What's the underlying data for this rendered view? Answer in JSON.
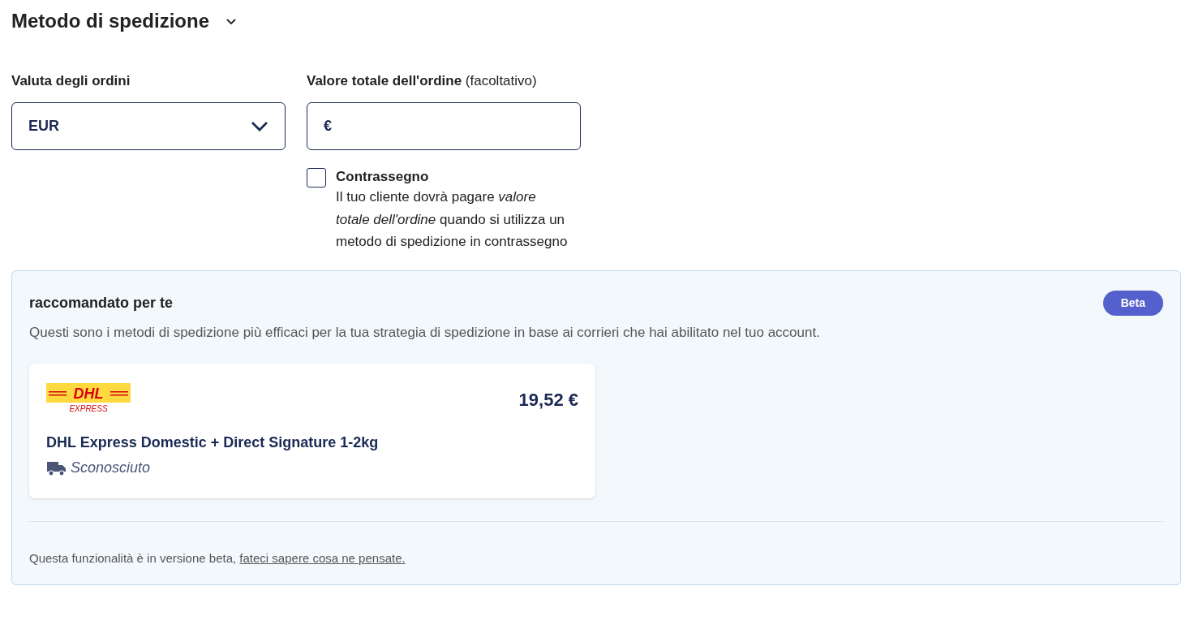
{
  "section": {
    "title": "Metodo di spedizione",
    "expanded": true
  },
  "currency": {
    "label": "Valuta degli ordini",
    "value": "EUR"
  },
  "order_value": {
    "label": "Valore totale dell'ordine",
    "label_note": "(facoltativo)",
    "prefix": "€"
  },
  "cash_on_delivery": {
    "label": "Contrassegno",
    "checked": false,
    "description": "Il tuo cliente dovrà pagare *valore totale dell'ordine* quando si utilizza un metodo di spedizione in contrassegno"
  },
  "recommended": {
    "title": "raccomandato per te",
    "badge": "Beta",
    "description": "Questi sono i metodi di spedizione più efficaci per la tua strategia di spedizione in base ai corrieri che hai abilitato nel tuo account.",
    "methods": [
      {
        "logo_text": "DHL",
        "logo_subtext": "EXPRESS",
        "price": "19,52 €",
        "name": "DHL Express Domestic + Direct Signature 1-2kg",
        "delivery": "Sconosciuto"
      }
    ],
    "footer": "Questa funzionalità è in versione beta,",
    "footer_link": "fateci sapere cosa ne pensate."
  }
}
